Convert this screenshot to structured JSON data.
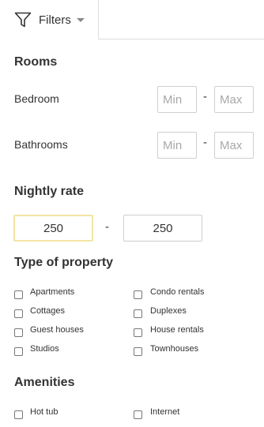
{
  "filters_tab": {
    "label": "Filters",
    "icon": "funnel-icon"
  },
  "rooms": {
    "title": "Rooms",
    "bedroom": {
      "label": "Bedroom",
      "min_placeholder": "Min",
      "max_placeholder": "Max",
      "separator": "-"
    },
    "bathrooms": {
      "label": "Bathrooms",
      "min_placeholder": "Min",
      "max_placeholder": "Max",
      "separator": "-"
    }
  },
  "nightly_rate": {
    "title": "Nightly rate",
    "min_value": "250",
    "max_value": "250",
    "separator": "-",
    "focus_color": "#f3e4a4"
  },
  "property_types": {
    "title": "Type of property",
    "items": [
      {
        "label": "Apartments",
        "checked": false
      },
      {
        "label": "Condo rentals",
        "checked": false
      },
      {
        "label": "Cottages",
        "checked": false
      },
      {
        "label": "Duplexes",
        "checked": false
      },
      {
        "label": "Guest houses",
        "checked": false
      },
      {
        "label": "House rentals",
        "checked": false
      },
      {
        "label": "Studios",
        "checked": false
      },
      {
        "label": "Townhouses",
        "checked": false
      }
    ]
  },
  "amenities": {
    "title": "Amenities",
    "items": [
      {
        "label": "Hot tub",
        "checked": false
      },
      {
        "label": "Internet",
        "checked": false
      }
    ]
  }
}
